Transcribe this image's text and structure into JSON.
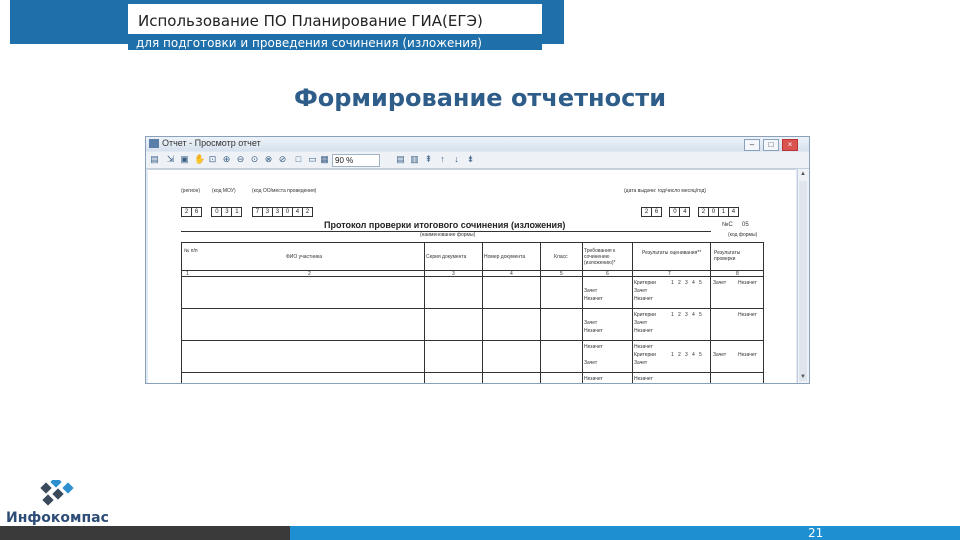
{
  "header": {
    "title": "Использование ПО Планирование ГИА(ЕГЭ)",
    "subtitle": "для подготовки и проведения сочинения (изложения)"
  },
  "slide_title": "Формирование отчетности",
  "window": {
    "title": "Отчет - Просмотр отчет",
    "zoom_value": "90 %",
    "buttons": {
      "minimize": "–",
      "maximize": "□",
      "close": "×"
    }
  },
  "report": {
    "header_labels": {
      "left_1": "(регион)",
      "left_2": "(код МОУ)",
      "left_3": "(код ОО/места проведения)",
      "right": "(дата выдачи: год/число месяц/год)"
    },
    "left_digits": [
      "2",
      "6",
      "0",
      "3",
      "1",
      "7",
      "3",
      "3",
      "0",
      "4",
      "2"
    ],
    "right_digits": [
      "2",
      "6",
      "0",
      "4",
      "2",
      "0",
      "1",
      "4"
    ],
    "doc_title": "Протокол проверки итогового сочинения (изложения)",
    "doc_subtitle": "(наименование формы)",
    "class_label": "№С",
    "class_value": "05",
    "class_hint": "(код формы)",
    "columns": [
      "№ п/п",
      "ФИО участника",
      "Серия документа",
      "Номер документа",
      "Класс",
      "Требования к сочинению (изложению)*",
      "Результаты оценивания**",
      "Результаты проверки"
    ],
    "col_numbers": [
      "1",
      "2",
      "3",
      "4",
      "5",
      "6",
      "7",
      "8"
    ],
    "criteria_label": "Критерии",
    "criteria_numbers": [
      "1",
      "2",
      "3",
      "4",
      "5"
    ],
    "zachet": "Зачет",
    "nezachet": "Незачет"
  },
  "logo": {
    "text": "Инфокомпас"
  },
  "footer": {
    "page_number": "21"
  }
}
